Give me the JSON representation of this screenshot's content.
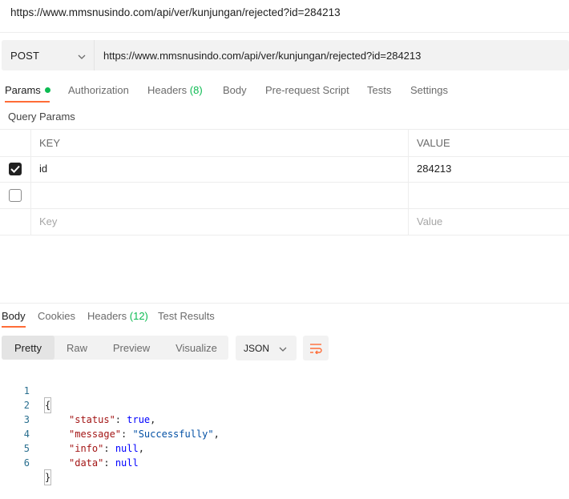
{
  "window": {
    "title_url": "https://www.mmsnusindo.com/api/ver/kunjungan/rejected?id=284213"
  },
  "request": {
    "method": "POST",
    "url": "https://www.mmsnusindo.com/api/ver/kunjungan/rejected?id=284213",
    "tabs": [
      {
        "label": "Params",
        "count": ""
      },
      {
        "label": "Authorization",
        "count": ""
      },
      {
        "label": "Headers",
        "count": "(8)"
      },
      {
        "label": "Body",
        "count": ""
      },
      {
        "label": "Pre-request Script",
        "count": ""
      },
      {
        "label": "Tests",
        "count": ""
      },
      {
        "label": "Settings",
        "count": ""
      }
    ],
    "active_tab": "Params",
    "query_params_title": "Query Params",
    "table": {
      "headers": {
        "key": "KEY",
        "value": "VALUE"
      },
      "rows": [
        {
          "checked": true,
          "key": "id",
          "value": "284213"
        },
        {
          "checked": false,
          "key": "",
          "value": ""
        }
      ],
      "placeholder": {
        "key": "Key",
        "value": "Value"
      }
    }
  },
  "response": {
    "tabs": [
      {
        "label": "Body",
        "count": ""
      },
      {
        "label": "Cookies",
        "count": ""
      },
      {
        "label": "Headers",
        "count": "(12)"
      },
      {
        "label": "Test Results",
        "count": ""
      }
    ],
    "active_tab": "Body",
    "views": [
      "Pretty",
      "Raw",
      "Preview",
      "Visualize"
    ],
    "active_view": "Pretty",
    "format": "JSON",
    "code_lines": [
      {
        "n": "1",
        "text": "{"
      },
      {
        "n": "2",
        "key": "\"status\"",
        "value": "true",
        "trail": ","
      },
      {
        "n": "3",
        "key": "\"message\"",
        "value": "\"Successfully\"",
        "trail": ","
      },
      {
        "n": "4",
        "key": "\"info\"",
        "value": "null",
        "trail": ","
      },
      {
        "n": "5",
        "key": "\"data\"",
        "value": "null",
        "trail": ""
      },
      {
        "n": "6",
        "text": "}"
      }
    ]
  },
  "colors": {
    "accent": "#ff6c37",
    "count_green": "#0cbb52",
    "json_key": "#a31515",
    "json_string": "#0451a5",
    "json_literal": "#0000ff"
  },
  "icons": {
    "method_dropdown": "chevron-down-icon",
    "format_dropdown": "chevron-down-icon",
    "wrap": "text-wrap-icon",
    "checkbox_on": "checkmark-icon"
  }
}
